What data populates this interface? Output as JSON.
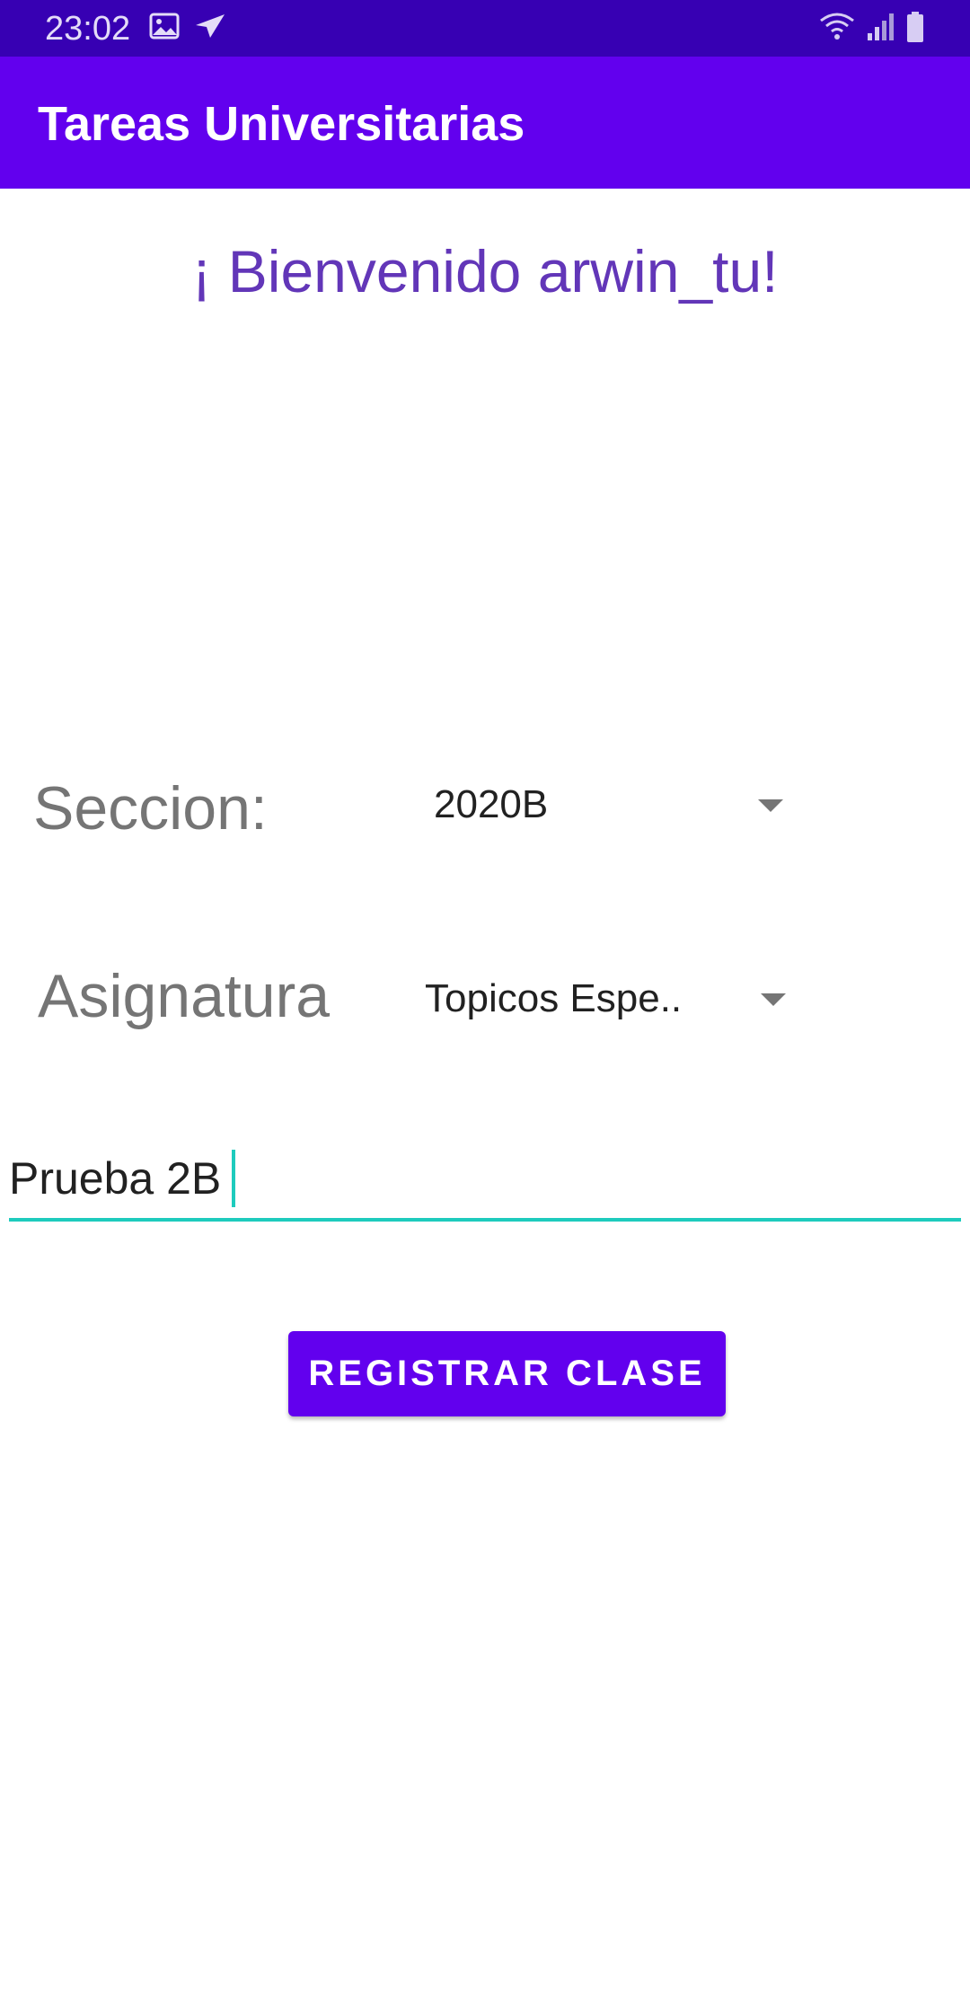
{
  "status_bar": {
    "time": "23:02",
    "left_icons": [
      "image-icon",
      "send-icon"
    ],
    "right_icons": [
      "wifi-icon",
      "signal-icon",
      "battery-icon"
    ],
    "color": "#3700B3"
  },
  "app_bar": {
    "title": "Tareas Universitarias",
    "color": "#6200EE"
  },
  "welcome": {
    "text": "¡ Bienvenido arwin_tu!",
    "color": "#6236b8"
  },
  "form": {
    "seccion": {
      "label": "Seccion:",
      "selected": "2020B"
    },
    "asignatura": {
      "label": "Asignatura",
      "selected": "Topicos Espe.."
    },
    "task_input": {
      "value": "Prueba 2B",
      "accent": "#1ecbbd"
    },
    "register_button": {
      "label": "REGISTRAR CLASE"
    }
  }
}
